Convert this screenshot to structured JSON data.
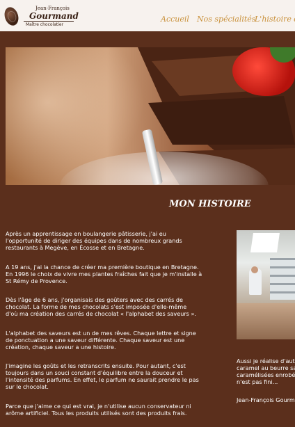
{
  "header": {
    "logo_top": "Jean-François",
    "logo_name": "Gourmand",
    "logo_sub": "Maître chocolatier",
    "nav": [
      "Accueil",
      "Nos spécialités",
      "L'histoire du"
    ]
  },
  "page_title": "MON HISTOIRE",
  "paragraphs": [
    [
      "Après un apprentissage en boulangerie pâtisserie, j'ai eu",
      "l'opportunité de diriger des équipes dans de nombreux grands",
      "restaurants à Megève, en Écosse et en Bretagne."
    ],
    [
      "A 19 ans, j'ai la chance de créer ma première boutique en Bretagne.",
      "En 1996 le choix de vivre mes plantes fraîches fait que je m'installe à",
      "St Rémy de Provence."
    ],
    [
      "Dès l'âge de 6 ans, j'organisais des goûters avec des carrés de",
      "chocolat. La forme de mes chocolats s'est imposée d'elle-même",
      "d'où ma création des carrés de chocolat « l'alphabet des saveurs »."
    ],
    [
      "L'alphabet des saveurs est un de mes rêves. Chaque lettre et signe",
      "de ponctuation a une saveur différente. Chaque saveur est une",
      "création, chaque saveur a une histoire."
    ],
    [
      "J'imagine les goûts et les retranscrits ensuite. Pour autant, c'est",
      "toujours dans un souci constant d'équilibre entre la douceur et",
      "l'intensité des parfums. En effet, le parfum ne saurait prendre le pas",
      "sur le chocolat."
    ],
    [
      "Parce que j'aime ce qui est vrai, je n'utilise aucun conservateur ni",
      "arôme artificiel. Tous les produits utilisés sont des produits frais."
    ]
  ],
  "side_text": [
    "Aussi je réalise d'aut",
    "caramel au beurre sa",
    "caramélisées enrobé",
    "n'est pas fini..."
  ],
  "signature": "Jean-François Gourm",
  "colors": {
    "background": "#5b2f1c",
    "header": "#f7f2ee",
    "nav": "#c9913b"
  }
}
